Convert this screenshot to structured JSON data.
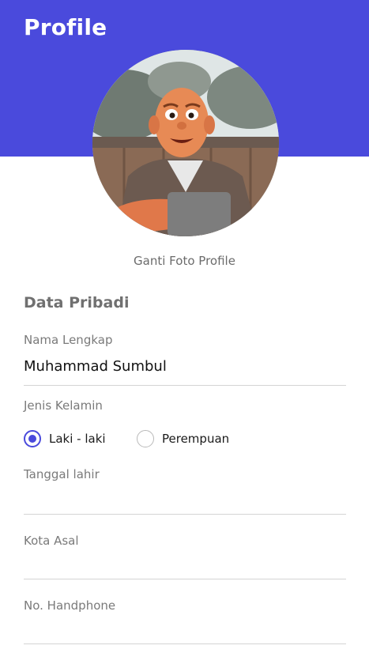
{
  "header": {
    "title": "Profile",
    "color": "#4a4adc"
  },
  "avatar": {
    "icon": "profile-photo",
    "change_label": "Ganti Foto Profile"
  },
  "section": {
    "title": "Data Pribadi"
  },
  "fields": {
    "full_name": {
      "label": "Nama Lengkap",
      "value": "Muhammad Sumbul"
    },
    "gender": {
      "label": "Jenis Kelamin",
      "options": [
        "Laki - laki",
        "Perempuan"
      ],
      "selected": "Laki - laki"
    },
    "birth_date": {
      "label": "Tanggal lahir",
      "value": ""
    },
    "city": {
      "label": "Kota Asal",
      "value": ""
    },
    "phone": {
      "label": "No. Handphone",
      "value": ""
    }
  }
}
